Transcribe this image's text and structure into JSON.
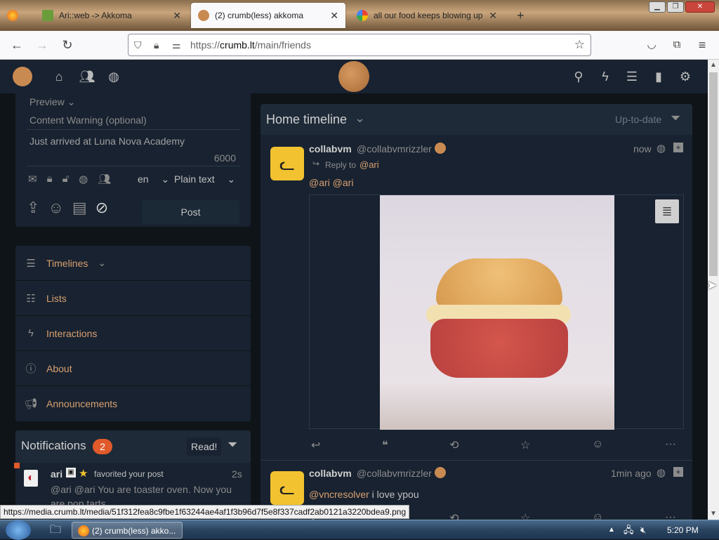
{
  "browser": {
    "tabs": [
      {
        "title": "Ari::web -> Akkoma"
      },
      {
        "title": "(2) crumb(less) akkoma"
      },
      {
        "title": "all our food keeps blowing up"
      }
    ],
    "url_prefix": "https://",
    "url_domain": "crumb.lt",
    "url_path": "/main/friends",
    "status_url": "https://media.crumb.lt/media/51f312fea8c9fbe1f63244ae4af1f3b96d7f5e8f337cadf2ab0121a3220bdea9.png"
  },
  "compose": {
    "preview_label": "Preview",
    "content_warning_placeholder": "Content Warning (optional)",
    "status_text": "Just arrived at Luna Nova Academy",
    "char_count": "6000",
    "language": "en",
    "format": "Plain text",
    "post_label": "Post"
  },
  "sidenav": {
    "items": [
      {
        "label": "Timelines"
      },
      {
        "label": "Lists"
      },
      {
        "label": "Interactions"
      },
      {
        "label": "About"
      },
      {
        "label": "Announcements"
      }
    ]
  },
  "notifications": {
    "title": "Notifications",
    "count": "2",
    "read_label": "Read!",
    "item": {
      "user": "ari",
      "action": "favorited your post",
      "time": "2s",
      "text": "@ari @ari You are toaster oven. Now you are pop tarts"
    }
  },
  "timeline": {
    "title": "Home timeline",
    "status_label": "Up-to-date",
    "posts": [
      {
        "name": "collabvm",
        "handle": "@collabvmrizzler",
        "time": "now",
        "reply_to_label": "Reply to",
        "reply_to": "@ari",
        "mention": "@ari @ari"
      },
      {
        "name": "collabvm",
        "handle": "@collabvmrizzler",
        "time": "1min ago",
        "mention": "@vncresolver",
        "text": " i love ypou"
      }
    ]
  },
  "taskbar": {
    "window_label": "(2) crumb(less) akko...",
    "clock": "5:20 PM"
  },
  "colors": {
    "accent": "#d8a070",
    "panel": "#182230",
    "bg": "#0f1419",
    "badge": "#e05a2b"
  }
}
